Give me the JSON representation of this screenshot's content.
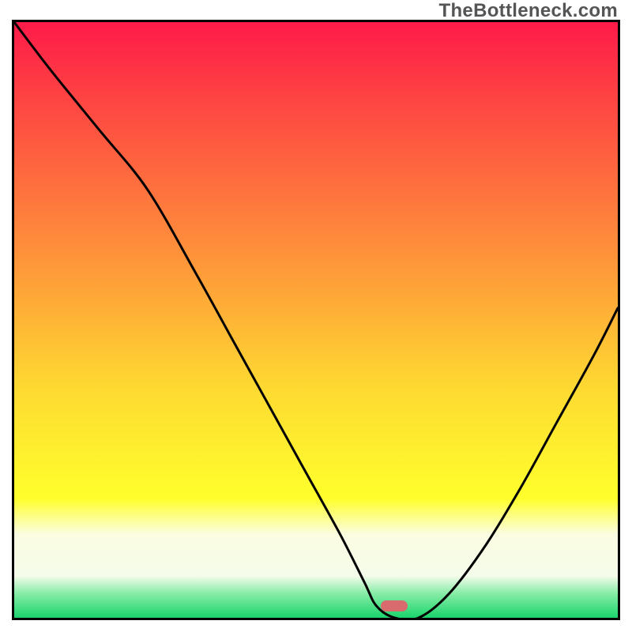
{
  "watermark": "TheBottleneck.com",
  "colors": {
    "top": "#fe1a49",
    "red": "#fe4143",
    "orange": "#fe953a",
    "yellow_mid": "#fedb31",
    "yellow_bright": "#ffff2c",
    "pale_band_top": "#fbfde2",
    "pale_band_bottom": "#f4fcea",
    "green_top": "#84eca5",
    "green_bottom": "#1bd46c",
    "border": "#000000",
    "curve": "#000000",
    "marker": "#d96a6e",
    "watermark_text": "#555555"
  },
  "marker": {
    "cx_frac": 0.63,
    "cy_frac": 0.98
  },
  "chart_data": {
    "type": "line",
    "title": "",
    "xlabel": "",
    "ylabel": "",
    "xlim": [
      0,
      100
    ],
    "ylim": [
      0,
      100
    ],
    "grid": false,
    "legend": false,
    "series": [
      {
        "name": "bottleneck-curve",
        "x": [
          0,
          6,
          14,
          22,
          30,
          36,
          42,
          48,
          54,
          58,
          60,
          63,
          67,
          72,
          78,
          84,
          90,
          96,
          100
        ],
        "y": [
          100,
          92,
          82,
          72,
          58,
          47,
          36,
          25,
          14,
          6,
          2,
          0,
          0,
          4,
          12,
          22,
          33,
          44,
          52
        ]
      }
    ],
    "markers": [
      {
        "name": "optimal-point",
        "x": 63,
        "y": 0
      }
    ],
    "annotations": []
  }
}
